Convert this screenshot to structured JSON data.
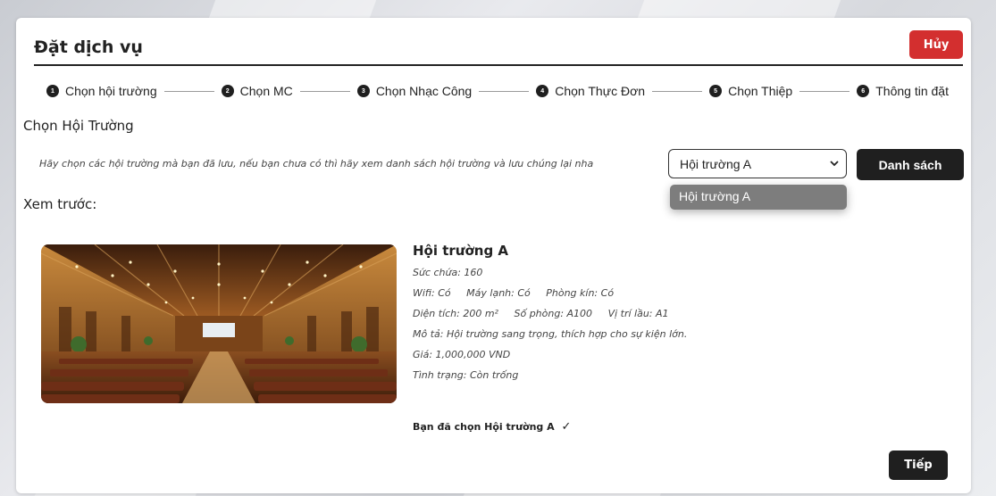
{
  "header": {
    "title": "Đặt dịch vụ",
    "cancel_label": "Hủy"
  },
  "steps": [
    {
      "num": "1",
      "label": "Chọn hội trường"
    },
    {
      "num": "2",
      "label": "Chọn MC"
    },
    {
      "num": "3",
      "label": "Chọn Nhạc Công"
    },
    {
      "num": "4",
      "label": "Chọn Thực Đơn"
    },
    {
      "num": "5",
      "label": "Chọn Thiệp"
    },
    {
      "num": "6",
      "label": "Thông tin đặt"
    }
  ],
  "section": {
    "title": "Chọn Hội Trường",
    "hint": "Hãy chọn các hội trường mà bạn đã lưu, nếu bạn chưa có thì hãy xem danh sách hội trường và lưu chúng lại nha",
    "select_value": "Hội trường A",
    "dropdown_option": "Hội trường A",
    "list_button": "Danh sách"
  },
  "preview": {
    "title": "Xem trước:",
    "hall_name": "Hội trường A",
    "capacity": "Sức chứa: 160",
    "wifi": "Wifi: Có",
    "ac": "Máy lạnh: Có",
    "private_room": "Phòng kín: Có",
    "area": "Diện tích: 200 m²",
    "room_no": "Số phòng: A100",
    "floor": "Vị trí lầu: A1",
    "description": "Mô tả: Hội trường sang trọng, thích hợp cho sự kiện lớn.",
    "price": "Giá: 1,000,000 VND",
    "status": "Tình trạng: Còn trống",
    "selected_text": "Bạn đã chọn Hội trường A",
    "check_mark": "✓"
  },
  "footer": {
    "next_label": "Tiếp"
  },
  "colors": {
    "danger": "#d32f2f",
    "dark": "#1f1f1f",
    "dropdown": "#7d7d7d"
  }
}
